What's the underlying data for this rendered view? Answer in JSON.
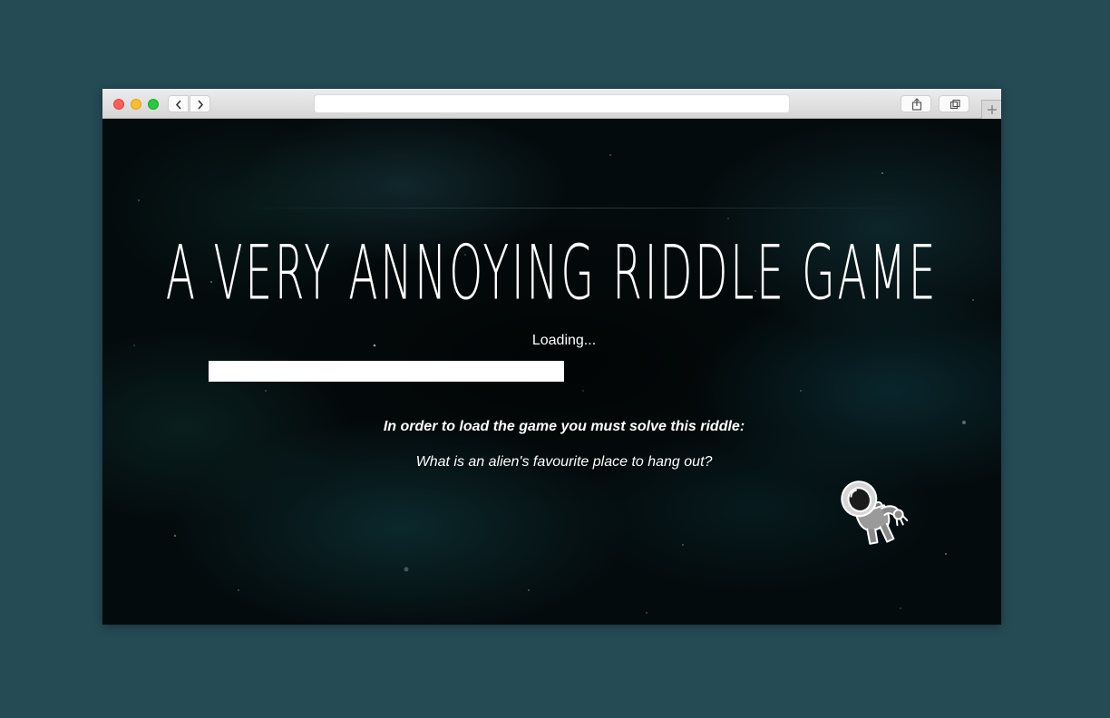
{
  "browser": {
    "url": "",
    "buttons": {
      "back": "chevron-left-icon",
      "forward": "chevron-right-icon",
      "share": "share-icon",
      "tabs": "tabs-icon",
      "new_tab": "plus-icon"
    },
    "traffic_lights": {
      "close": "#fc5f57",
      "minimize": "#fdbc2e",
      "zoom": "#28c840"
    }
  },
  "game": {
    "title": "A VERY ANNOYING RIDDLE GAME",
    "loading_label": "Loading...",
    "progress_fraction": 0.57,
    "riddle_intro": "In order to load the game you must solve this riddle:",
    "riddle_question": "What is an alien's favourite place to hang out?",
    "mascot_icon": "astronaut-icon"
  },
  "colors": {
    "backdrop": "#254b55",
    "space": "#040b0d",
    "text": "#ffffff",
    "progress": "#ffffff"
  }
}
